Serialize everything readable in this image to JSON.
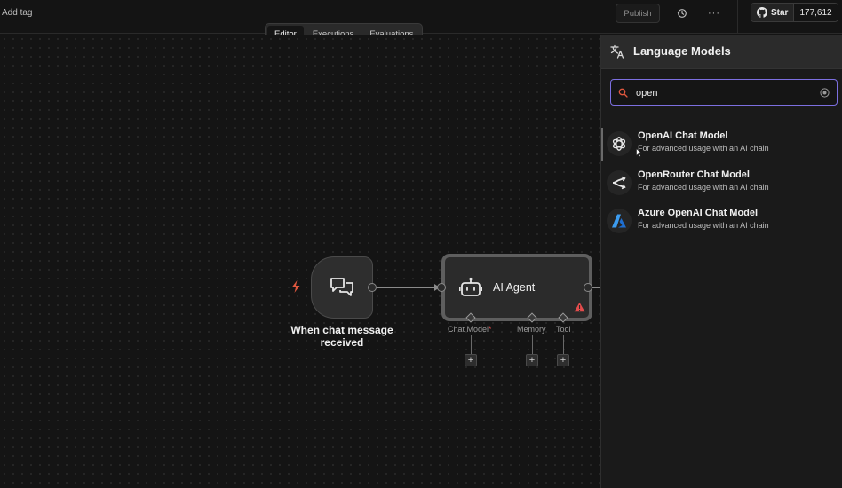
{
  "topbar": {
    "add_tag": "Add tag",
    "publish_label": "Publish",
    "history_icon": "history-icon",
    "more_label": "···",
    "github_star_label": "Star",
    "github_star_count": "177,612"
  },
  "tabs": [
    {
      "label": "Editor",
      "active": true
    },
    {
      "label": "Executions",
      "active": false
    },
    {
      "label": "Evaluations",
      "active": false
    }
  ],
  "canvas": {
    "trigger_node": {
      "title": "When chat message received",
      "icon": "chat-bubbles-icon"
    },
    "agent_node": {
      "title": "AI Agent",
      "icon": "robot-icon",
      "warning": true
    },
    "sub_connections": [
      {
        "label": "Chat Model",
        "required": true,
        "required_mark": "*"
      },
      {
        "label": "Memory",
        "required": false
      },
      {
        "label": "Tool",
        "required": false
      }
    ],
    "plus_label": "+"
  },
  "panel": {
    "title": "Language Models",
    "header_icon": "translate-icon",
    "search": {
      "value": "open",
      "placeholder": "Search"
    },
    "models": [
      {
        "name": "OpenAI Chat Model",
        "desc": "For advanced usage with an AI chain",
        "icon": "openai-icon",
        "active": true
      },
      {
        "name": "OpenRouter Chat Model",
        "desc": "For advanced usage with an AI chain",
        "icon": "openrouter-icon",
        "active": false
      },
      {
        "name": "Azure OpenAI Chat Model",
        "desc": "For advanced usage with an AI chain",
        "icon": "azure-icon",
        "active": false
      }
    ]
  },
  "colors": {
    "background": "#141414",
    "panel": "#1a1a1a",
    "accent_search_border": "#7c6fe0",
    "trigger_bolt": "#e0573e",
    "warning": "#e34c4c",
    "azure_blue": "#2f8be6"
  }
}
